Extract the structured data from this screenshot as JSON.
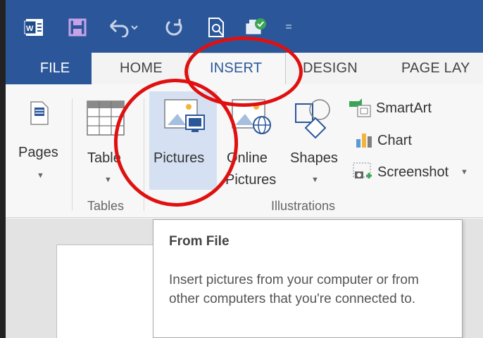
{
  "quick_access": {
    "word_icon": "word-app-icon",
    "more_label": "="
  },
  "tabs": {
    "file": "FILE",
    "home": "HOME",
    "insert": "INSERT",
    "design": "DESIGN",
    "page_layout": "PAGE LAY"
  },
  "ribbon": {
    "pages_label": "Pages",
    "table_label": "Table",
    "pictures_label": "Pictures",
    "online_pictures_line1": "Online",
    "online_pictures_line2": "Pictures",
    "shapes_label": "Shapes",
    "smartart_label": "SmartArt",
    "chart_label": "Chart",
    "screenshot_label": "Screenshot",
    "tables_group": "Tables",
    "illustrations_group": "Illustrations"
  },
  "tooltip": {
    "title": "From File",
    "body": "Insert pictures from your computer or from other computers that you're connected to."
  },
  "colors": {
    "accent": "#2b579a",
    "annotation": "#e01010",
    "highlight": "#d5e1f2"
  }
}
